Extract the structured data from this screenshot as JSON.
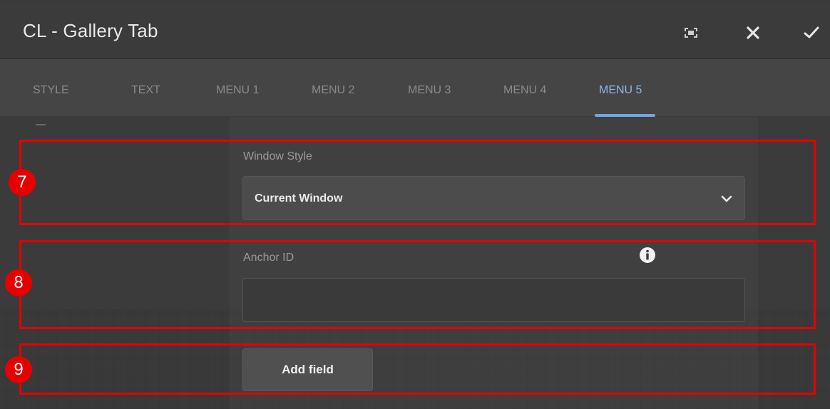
{
  "dialog": {
    "title": "CL - Gallery Tab",
    "buttons": {
      "fullscreen_icon": "fullscreen-icon",
      "close_icon": "close-icon",
      "confirm_icon": "checkmark-icon"
    }
  },
  "tabs": [
    {
      "label": "STYLE",
      "active": false
    },
    {
      "label": "TEXT",
      "active": false
    },
    {
      "label": "MENU 1",
      "active": false
    },
    {
      "label": "MENU 2",
      "active": false
    },
    {
      "label": "MENU 3",
      "active": false
    },
    {
      "label": "MENU 4",
      "active": false
    },
    {
      "label": "MENU 5",
      "active": true
    }
  ],
  "form": {
    "window_style": {
      "label": "Window Style",
      "value": "Current Window"
    },
    "anchor_id": {
      "label": "Anchor ID",
      "value": "",
      "info_icon": "info-icon"
    },
    "add_field_label": "Add field"
  },
  "annotations": [
    {
      "number": "7"
    },
    {
      "number": "8"
    },
    {
      "number": "9"
    }
  ],
  "colors": {
    "accent": "#6fa6e6",
    "annotation_red": "#e60000",
    "background": "#3e3e3e"
  }
}
